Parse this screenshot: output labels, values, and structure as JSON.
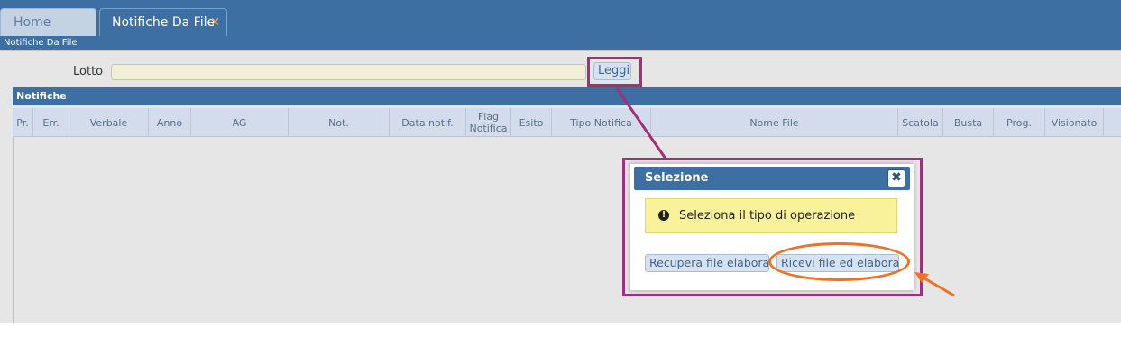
{
  "tabs": [
    {
      "label": "Home"
    },
    {
      "label": "Notifiche Da File",
      "close_icon": "×"
    }
  ],
  "breadcrumb": "Notifiche Da File",
  "form": {
    "lotto_label": "Lotto",
    "lotto_value": "",
    "leggi_button": "Leggi"
  },
  "grid": {
    "title": "Notifiche",
    "columns": [
      {
        "label": "Pr."
      },
      {
        "label": "Err."
      },
      {
        "label": "Verbale"
      },
      {
        "label": "Anno"
      },
      {
        "label": "AG"
      },
      {
        "label": "Not."
      },
      {
        "label": "Data notif."
      },
      {
        "label": "Flag Notifica"
      },
      {
        "label": "Esito"
      },
      {
        "label": "Tipo Notifica"
      },
      {
        "label": "Nome File"
      },
      {
        "label": "Scatola"
      },
      {
        "label": "Busta"
      },
      {
        "label": "Prog."
      },
      {
        "label": "Visionato"
      }
    ],
    "rows": []
  },
  "dialog": {
    "title": "Selezione",
    "close_icon": "✖",
    "message": "Seleziona il tipo di operazione",
    "warning_icon": "!",
    "buttons": {
      "recupera": "Recupera file elaborati",
      "ricevi": "Ricevi file ed elabora"
    }
  },
  "colors": {
    "header_blue": "#3d6fa3",
    "highlight_magenta": "#a0307a",
    "annotation_orange": "#ee7124",
    "warning_yellow": "#faf29a"
  }
}
